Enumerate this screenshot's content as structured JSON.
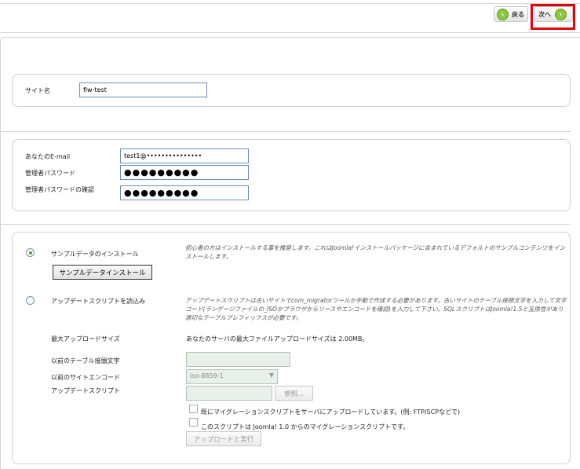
{
  "nav": {
    "back_label": "戻る",
    "next_label": "次へ",
    "back_icon": "arrow-left-icon",
    "next_icon": "arrow-right-icon",
    "accent": "#8cc63f",
    "highlight_color": "#e0000f"
  },
  "site": {
    "site_name_label": "サイト名",
    "site_name_value": "fiw-test"
  },
  "admin": {
    "email_label": "あなたのE-mail",
    "email_value": "test1@•••••••••••••••",
    "password_label": "管理者パスワード",
    "password_value": "●●●●●●●●●",
    "password_confirm_label": "管理者パスワードの確認",
    "password_confirm_value": "●●●●●●●●●"
  },
  "sample": {
    "install_label": "サンプルデータのインストール",
    "install_button": "サンプルデータインストール",
    "install_note": "初心者の方はインストールする事を推奨します。これはJoomla!インストールパッケージに含まれているデフォルトのサンプルコンテンツをインストールします。",
    "migrate_label": "アップデートスクリプトを読込み",
    "migrate_note": "アップデートスクリプトは古いサイトでcom_migratorツールか手動で作成する必要があります。古いサイトのテーブル接頭文字を入力して文字コード(ランゲージファイルの_ISOかブラウザからソースやエンコードを確認)を入力して下さい。SQLスクリプトはJoomla!1.5と互換性があり適切なテーブルプレフィックスが必要です。",
    "max_upload_label": "最大アップロードサイズ",
    "max_upload_value": "あなたのサーバの最大ファイルアップロードサイズは 2.00MB。",
    "old_prefix_label": "以前のテーブル接頭文字",
    "old_encoding_label": "以前のサイトエンコード",
    "old_encoding_value": "iso-8859-1",
    "update_script_label": "アップデートスクリプト",
    "browse_button": "参照...",
    "checkbox1_label": "既にマイグレーションスクリプトをサーバにアップロードしています。(例: FTP/SCPなどで)",
    "checkbox2_label": "このスクリプトは Joomla! 1.0 からのマイグレーションスクリプトです。",
    "upload_button": "アップロードと実行"
  }
}
